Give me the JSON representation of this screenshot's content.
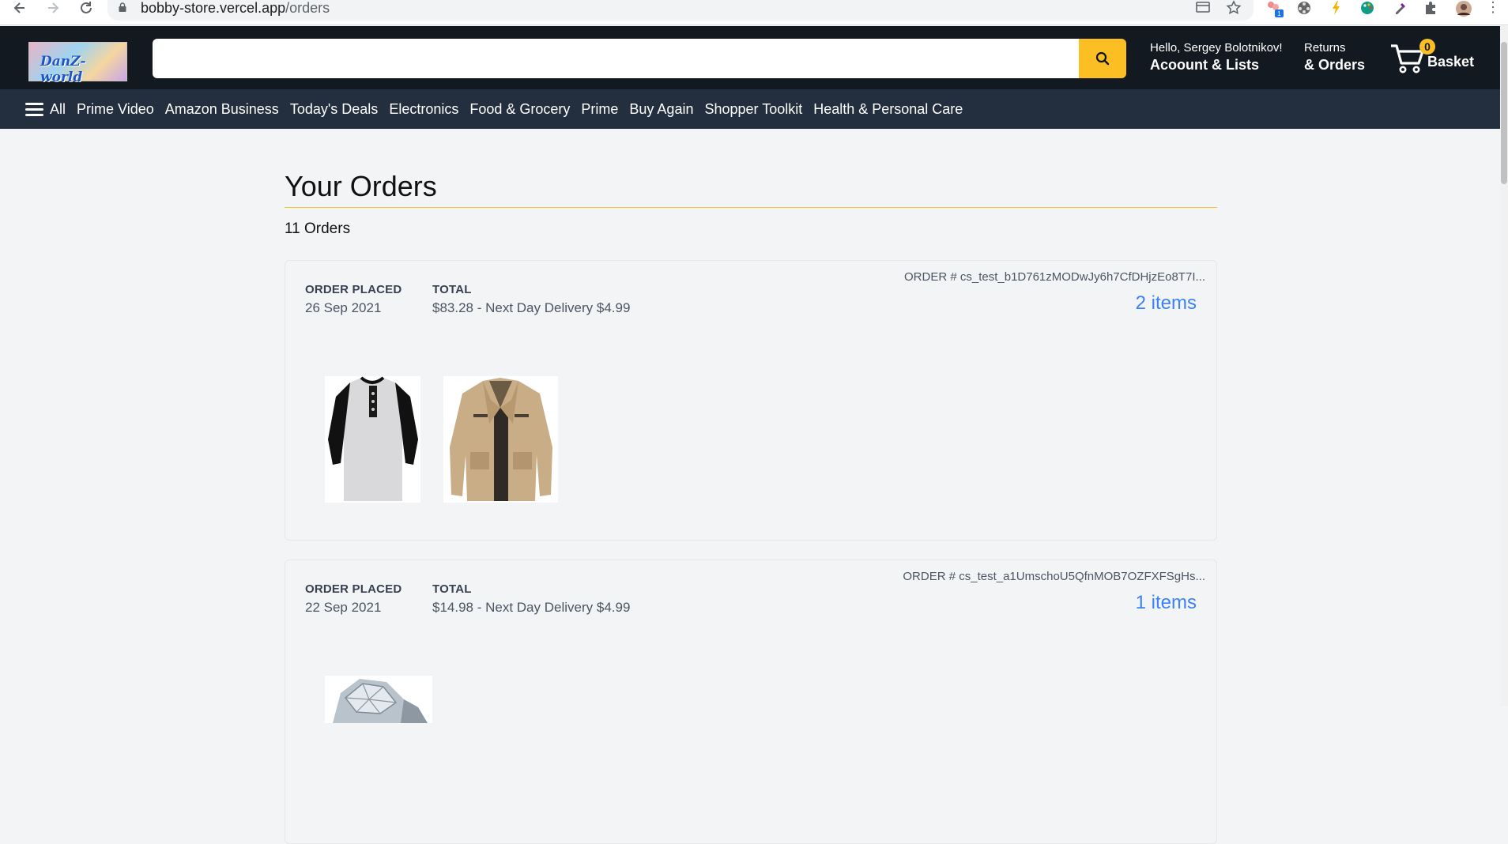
{
  "browser": {
    "url_host": "bobby-store.vercel.app",
    "url_path": "/orders"
  },
  "header": {
    "logo_text": "DanZ-world",
    "search_placeholder": "",
    "greeting": "Hello, Sergey Bolotnikov!",
    "account_label": "Acoount & Lists",
    "returns_label": "Returns",
    "orders_label": "& Orders",
    "basket_count": "0",
    "basket_label": "Basket"
  },
  "nav": {
    "all_label": "All",
    "items": [
      "Prime Video",
      "Amazon Business",
      "Today's Deals",
      "Electronics",
      "Food & Grocery",
      "Prime",
      "Buy Again",
      "Shopper Toolkit",
      "Health & Personal Care"
    ]
  },
  "page": {
    "title": "Your Orders",
    "count_text": "11 Orders"
  },
  "orders": [
    {
      "placed_label": "ORDER PLACED",
      "placed_date": "26 Sep 2021",
      "total_label": "TOTAL",
      "total_value": "$83.28 - Next Day Delivery $4.99",
      "order_id": "ORDER # cs_test_b1D761zMODwJy6h7CfDHjzEo8T7I...",
      "items_text": "2 items"
    },
    {
      "placed_label": "ORDER PLACED",
      "placed_date": "22 Sep 2021",
      "total_label": "TOTAL",
      "total_value": "$14.98 - Next Day Delivery $4.99",
      "order_id": "ORDER # cs_test_a1UmschoU5QfnMOB7OZFXFSgHs...",
      "items_text": "1 items"
    }
  ],
  "colors": {
    "header_bg": "#131921",
    "subnav_bg": "#232f3e",
    "accent": "#fbbf24",
    "link": "#3b82f6"
  }
}
